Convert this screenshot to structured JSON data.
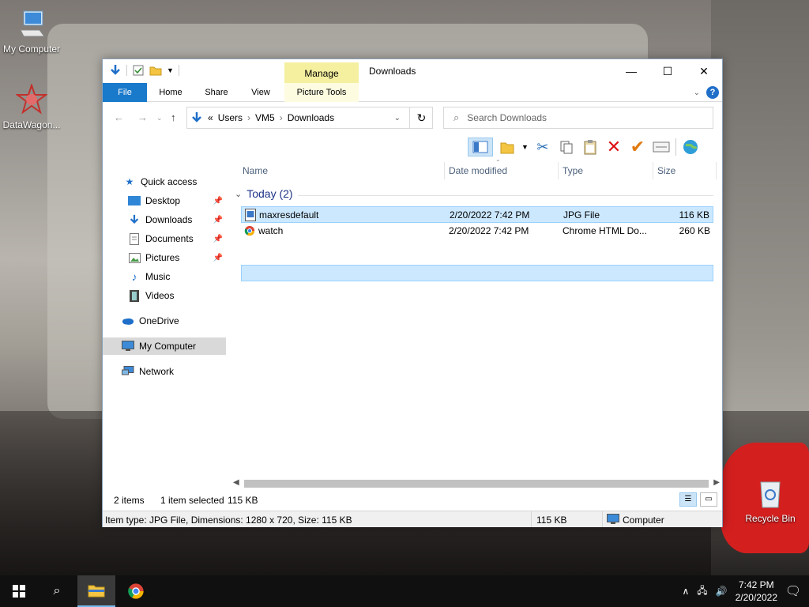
{
  "desktop": {
    "icons": [
      {
        "label": "My Computer",
        "icon": "computer-icon"
      },
      {
        "label": "DataWagon...",
        "icon": "datawagon-icon"
      },
      {
        "label": "Recycle Bin",
        "icon": "recycle-bin-icon"
      }
    ]
  },
  "window": {
    "title": "Downloads",
    "manage_label": "Manage",
    "tabs": [
      {
        "label": "File"
      },
      {
        "label": "Home"
      },
      {
        "label": "Share"
      },
      {
        "label": "View"
      },
      {
        "label": "Picture Tools"
      }
    ],
    "controls": {
      "minimize": "—",
      "maximize": "☐",
      "close": "✕"
    }
  },
  "address": {
    "path": [
      {
        "label": "«"
      },
      {
        "label": "Users"
      },
      {
        "label": "VM5"
      },
      {
        "label": "Downloads"
      }
    ],
    "search_placeholder": "Search Downloads"
  },
  "nav": {
    "items": [
      {
        "label": "Quick access",
        "icon": "star-icon"
      },
      {
        "label": "Desktop",
        "icon": "desktop-icon",
        "pinned": true
      },
      {
        "label": "Downloads",
        "icon": "download-icon",
        "pinned": true
      },
      {
        "label": "Documents",
        "icon": "document-icon",
        "pinned": true
      },
      {
        "label": "Pictures",
        "icon": "pictures-icon",
        "pinned": true
      },
      {
        "label": "Music",
        "icon": "music-icon"
      },
      {
        "label": "Videos",
        "icon": "video-icon"
      },
      {
        "label": "OneDrive",
        "icon": "cloud-icon"
      },
      {
        "label": "My Computer",
        "icon": "computer-icon"
      },
      {
        "label": "Network",
        "icon": "network-icon"
      }
    ]
  },
  "columns": [
    "Name",
    "Date modified",
    "Type",
    "Size"
  ],
  "group": {
    "label": "Today (2)"
  },
  "files": [
    {
      "name": "maxresdefault",
      "date": "2/20/2022 7:42 PM",
      "type": "JPG File",
      "size": "116 KB"
    },
    {
      "name": "watch",
      "date": "2/20/2022 7:42 PM",
      "type": "Chrome HTML Do...",
      "size": "260 KB"
    }
  ],
  "status": {
    "items": "2 items",
    "selected": "1 item selected",
    "selected_size": "115 KB"
  },
  "details": {
    "info": "Item type: JPG File, Dimensions: 1280 x 720, Size: 115 KB",
    "size": "115 KB",
    "location": "Computer"
  },
  "taskbar": {
    "time": "7:42 PM",
    "date": "2/20/2022"
  },
  "colors": {
    "accent": "#1979ca",
    "selection": "#cce8ff",
    "manage_tab": "#f5f0a0"
  }
}
